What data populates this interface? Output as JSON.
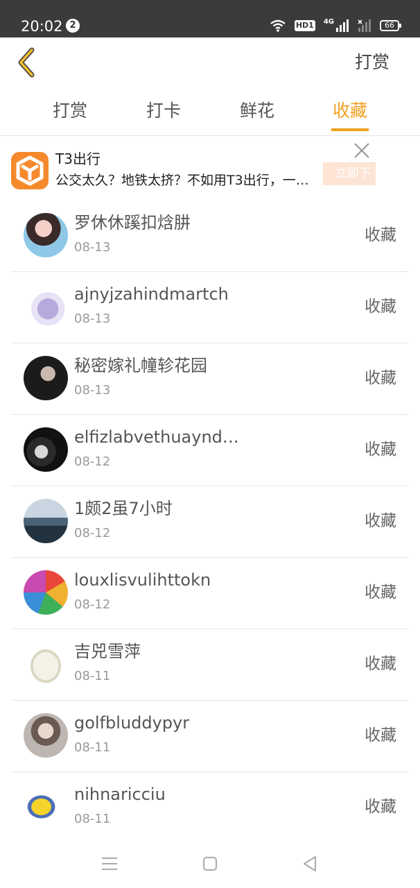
{
  "status_bar": {
    "time": "20:02",
    "notification_count": "2",
    "network": "4G",
    "hd_label": "HD1",
    "battery": "66"
  },
  "header": {
    "back_icon": "chevron-left-icon",
    "action_label": "打赏"
  },
  "tabs": [
    {
      "label": "打赏",
      "active": false
    },
    {
      "label": "打卡",
      "active": false
    },
    {
      "label": "鲜花",
      "active": false
    },
    {
      "label": "收藏",
      "active": true
    }
  ],
  "accent_color": "#f0a020",
  "ad": {
    "title": "T3出行",
    "description": "公交太久？地铁太挤？不如用T3出行，一…",
    "cta_label": "立即下",
    "close_icon": "close-icon"
  },
  "list": [
    {
      "name": "罗休休蹊扣焓肼",
      "date": "08-13",
      "action": "收藏"
    },
    {
      "name": "ajnyjzahindmartch",
      "date": "08-13",
      "action": "收藏"
    },
    {
      "name": "秘密嫁礼幢轸花园",
      "date": "08-13",
      "action": "收藏"
    },
    {
      "name": "elfizlabvethuayndj…",
      "date": "08-12",
      "action": "收藏"
    },
    {
      "name": "1颇2虽7小时",
      "date": "08-12",
      "action": "收藏"
    },
    {
      "name": "louxlisvulihttokn",
      "date": "08-12",
      "action": "收藏"
    },
    {
      "name": "吉兕雪萍",
      "date": "08-11",
      "action": "收藏"
    },
    {
      "name": "golfbluddypyr",
      "date": "08-11",
      "action": "收藏"
    },
    {
      "name": "nihnaricciu",
      "date": "08-11",
      "action": "收藏"
    }
  ],
  "nav_bar": {
    "menu_icon": "menu-icon",
    "home_icon": "home-square-icon",
    "back_icon": "back-triangle-icon"
  }
}
